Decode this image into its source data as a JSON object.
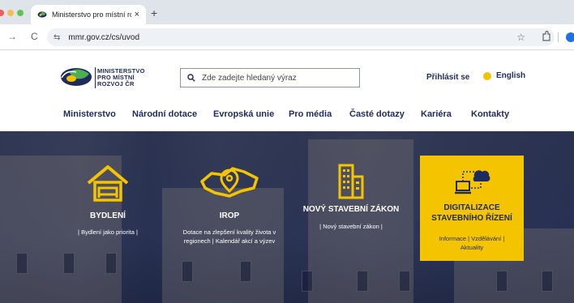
{
  "browser": {
    "tab_title": "Ministerstvo pro místní rozvoj ČR",
    "tab_close": "×",
    "new_tab": "+",
    "url": "mmr.gov.cz/cs/uvod",
    "nav_forward": "→",
    "nav_reload": "C",
    "tune_icon": "⇆",
    "bookmark_star": "☆"
  },
  "header": {
    "logo_lines": [
      "MINISTERSTVO",
      "PRO MÍSTNÍ",
      "ROZVOJ ČR"
    ],
    "search_placeholder": "Zde zadejte hledaný výraz",
    "login": "Přihlásit se",
    "language": "English"
  },
  "nav": {
    "items": [
      "Ministerstvo",
      "Národní dotace",
      "Evropská unie",
      "Pro média",
      "Časté dotazy",
      "Kariéra",
      "Kontakty"
    ]
  },
  "hero": {
    "tiles": [
      {
        "title": "BYDLENÍ",
        "links": "| Bydlení jako priorita |"
      },
      {
        "title": "IROP",
        "links": "Dotace na zlepšení kvality života v regionech | Kalendář akcí a výzev"
      },
      {
        "title": "NOVÝ STAVEBNÍ ZÁKON",
        "links": "| Nový stavební zákon |"
      },
      {
        "title": "DIGITALIZACE STAVEBNÍHO ŘÍZENÍ",
        "links": "Informace | Vzdělávání | Aktuality"
      }
    ]
  },
  "colors": {
    "brand_navy": "#1d2b5e",
    "accent_yellow": "#f5c400",
    "hero_overlay": "#1a2652"
  }
}
